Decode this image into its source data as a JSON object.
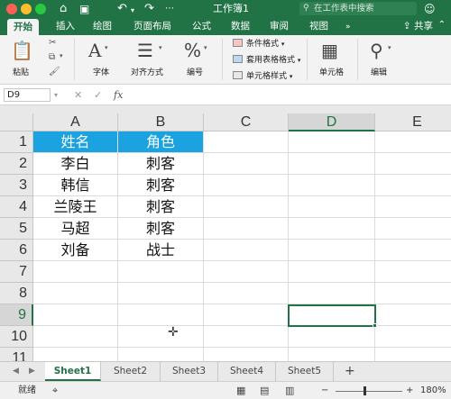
{
  "titlebar": {
    "title": "工作簿1",
    "search_placeholder": "在工作表中搜索",
    "traffic_colors": [
      "#fe5f57",
      "#febc2e",
      "#28c840"
    ]
  },
  "ribbon_tabs": [
    "开始",
    "插入",
    "绘图",
    "页面布局",
    "公式",
    "数据",
    "审阅",
    "视图"
  ],
  "share_label": "共享",
  "ribbon": {
    "paste": "粘贴",
    "font": "字体",
    "align": "对齐方式",
    "number": "编号",
    "conditional_format": "条件格式",
    "table_format": "套用表格格式",
    "cell_style": "单元格样式",
    "cells": "单元格",
    "edit": "编辑"
  },
  "formula_bar": {
    "name_box": "D9",
    "fx": "fx",
    "formula": ""
  },
  "columns": [
    "A",
    "B",
    "C",
    "D",
    "E"
  ],
  "rows": [
    "1",
    "2",
    "3",
    "4",
    "5",
    "6",
    "7",
    "8",
    "9",
    "10",
    "11"
  ],
  "cells": {
    "a1": "姓名",
    "b1": "角色",
    "a2": "李白",
    "b2": "刺客",
    "a3": "韩信",
    "b3": "刺客",
    "a4": "兰陵王",
    "b4": "刺客",
    "a5": "马超",
    "b5": "刺客",
    "a6": "刘备",
    "b6": "战士"
  },
  "selected_cell": "D9",
  "header_fill_color": "#1aa3e0",
  "accent_color": "#217346",
  "sheet_tabs": [
    "Sheet1",
    "Sheet2",
    "Sheet3",
    "Sheet4",
    "Sheet5"
  ],
  "active_sheet": "Sheet1",
  "add_sheet": "+",
  "status": {
    "ready": "就绪",
    "zoom": "180%",
    "zoom_minus": "−",
    "zoom_plus": "+"
  }
}
